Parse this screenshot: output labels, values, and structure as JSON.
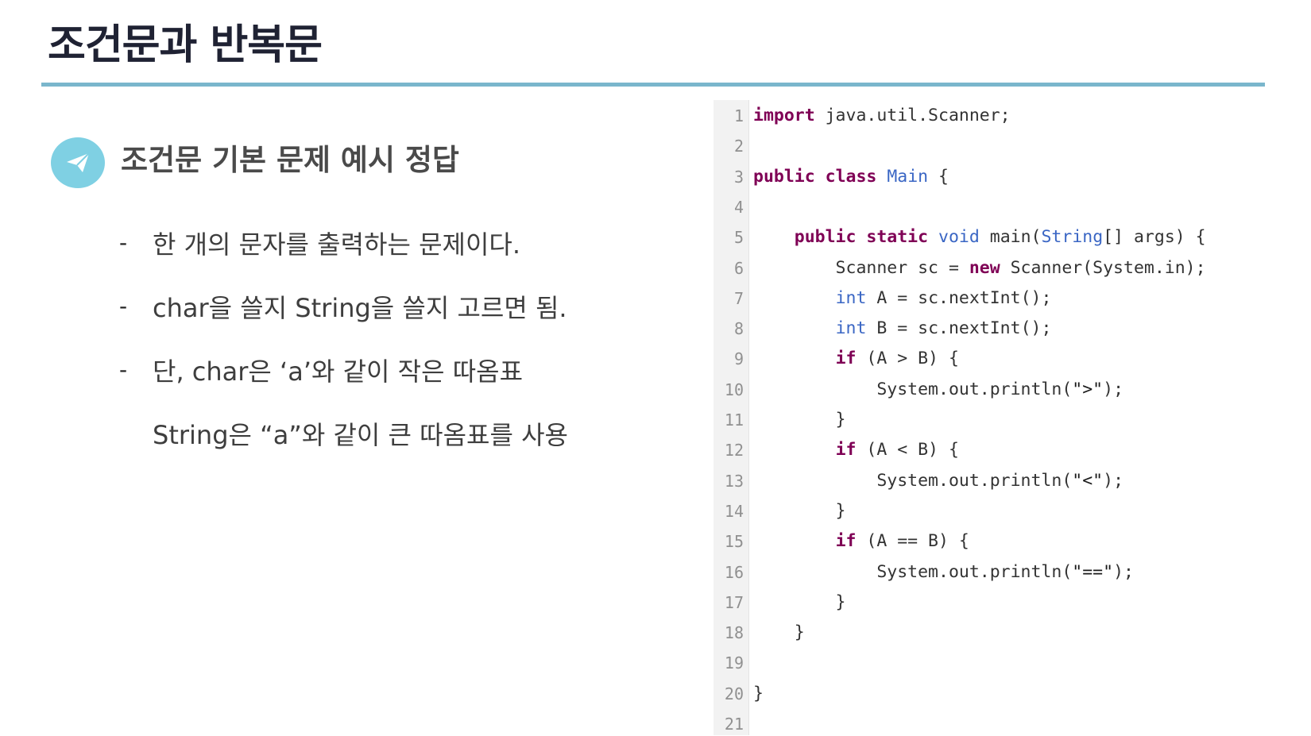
{
  "slide": {
    "title": "조건문과 반복문",
    "section_icon": "paper-plane-icon",
    "section_title": "조건문 기본 문제 예시 정답",
    "accent_color": "#7ab6cc",
    "icon_bg_color": "#7fd0e3"
  },
  "bullets": [
    {
      "dash": "-",
      "text": "한 개의 문자를 출력하는 문제이다."
    },
    {
      "dash": "-",
      "text": "char을 쓸지 String을 쓸지 고르면 됨."
    },
    {
      "dash": "-",
      "text": "단, char은 ‘a’와 같이 작은 따옴표"
    },
    {
      "dash": "",
      "text": "String은 “a”와 같이 큰 따옴표를 사용"
    }
  ],
  "code": {
    "line_numbers": [
      "1",
      "2",
      "3",
      "4",
      "5",
      "6",
      "7",
      "8",
      "9",
      "10",
      "11",
      "12",
      "13",
      "14",
      "15",
      "16",
      "17",
      "18",
      "19",
      "20",
      "21"
    ],
    "lines": [
      [
        {
          "t": "import",
          "c": "kw"
        },
        {
          "t": " java.util.Scanner;",
          "c": ""
        }
      ],
      [],
      [
        {
          "t": "public",
          "c": "kw"
        },
        {
          "t": " ",
          "c": ""
        },
        {
          "t": "class",
          "c": "kw"
        },
        {
          "t": " ",
          "c": ""
        },
        {
          "t": "Main",
          "c": "ty"
        },
        {
          "t": " {",
          "c": ""
        }
      ],
      [],
      [
        {
          "t": "    ",
          "c": ""
        },
        {
          "t": "public",
          "c": "kw"
        },
        {
          "t": " ",
          "c": ""
        },
        {
          "t": "static",
          "c": "kw"
        },
        {
          "t": " ",
          "c": ""
        },
        {
          "t": "void",
          "c": "ty"
        },
        {
          "t": " main(",
          "c": ""
        },
        {
          "t": "String",
          "c": "ty"
        },
        {
          "t": "[] args) {",
          "c": ""
        }
      ],
      [
        {
          "t": "        Scanner sc = ",
          "c": ""
        },
        {
          "t": "new",
          "c": "kw"
        },
        {
          "t": " Scanner(System.in);",
          "c": ""
        }
      ],
      [
        {
          "t": "        ",
          "c": ""
        },
        {
          "t": "int",
          "c": "ty"
        },
        {
          "t": " A = sc.nextInt();",
          "c": ""
        }
      ],
      [
        {
          "t": "        ",
          "c": ""
        },
        {
          "t": "int",
          "c": "ty"
        },
        {
          "t": " B = sc.nextInt();",
          "c": ""
        }
      ],
      [
        {
          "t": "        ",
          "c": ""
        },
        {
          "t": "if",
          "c": "kw"
        },
        {
          "t": " (A > B) {",
          "c": ""
        }
      ],
      [
        {
          "t": "            System.out.println(",
          "c": ""
        },
        {
          "t": "\">\"",
          "c": "str"
        },
        {
          "t": ");",
          "c": ""
        }
      ],
      [
        {
          "t": "        }",
          "c": ""
        }
      ],
      [
        {
          "t": "        ",
          "c": ""
        },
        {
          "t": "if",
          "c": "kw"
        },
        {
          "t": " (A < B) {",
          "c": ""
        }
      ],
      [
        {
          "t": "            System.out.println(",
          "c": ""
        },
        {
          "t": "\"<\"",
          "c": "str"
        },
        {
          "t": ");",
          "c": ""
        }
      ],
      [
        {
          "t": "        }",
          "c": ""
        }
      ],
      [
        {
          "t": "        ",
          "c": ""
        },
        {
          "t": "if",
          "c": "kw"
        },
        {
          "t": " (A == B) {",
          "c": ""
        }
      ],
      [
        {
          "t": "            System.out.println(",
          "c": ""
        },
        {
          "t": "\"==\"",
          "c": "str"
        },
        {
          "t": ");",
          "c": ""
        }
      ],
      [
        {
          "t": "        }",
          "c": ""
        }
      ],
      [
        {
          "t": "    }",
          "c": ""
        }
      ],
      [],
      [
        {
          "t": "}",
          "c": ""
        }
      ],
      []
    ]
  }
}
